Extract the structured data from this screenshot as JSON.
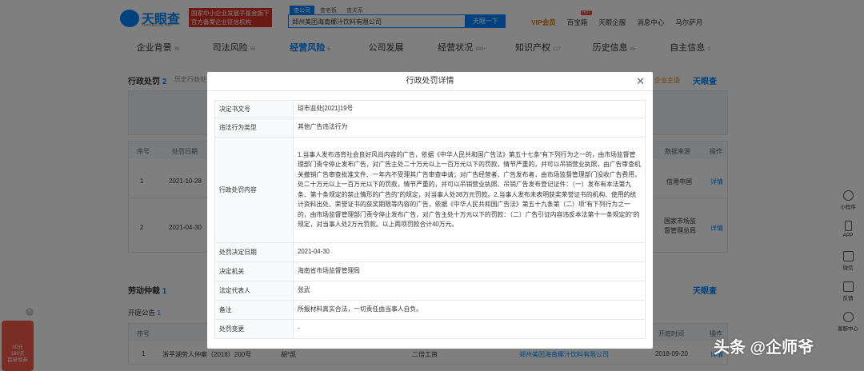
{
  "header": {
    "logo_text": "天眼查",
    "logo_sub": "TianYanCha.com",
    "promo_line1": "国家中小企业发展子基金旗下",
    "promo_line2": "官方备案企业征信机构",
    "search_tabs": [
      "查公司",
      "查老板",
      "查关系"
    ],
    "search_value": "郑州美团海南椰汁饮料有限公司",
    "search_button": "天眼一下",
    "links": {
      "vip": "VIP会员",
      "baibao": "百宝箱",
      "hot": "HOT",
      "enterprise": "天眼企服",
      "messages": "消息中心",
      "user": "马尔萨月"
    }
  },
  "nav": [
    {
      "label": "企业背景",
      "count": "38"
    },
    {
      "label": "司法风险",
      "count": "59"
    },
    {
      "label": "经营风险",
      "count": "5"
    },
    {
      "label": "公司发展",
      "count": ""
    },
    {
      "label": "经营状况",
      "count": "999+"
    },
    {
      "label": "知识产权",
      "count": "127"
    },
    {
      "label": "历史信息",
      "count": "65"
    },
    {
      "label": "自主信息",
      "count": "1"
    }
  ],
  "penalty_section": {
    "title": "行政处罚",
    "count": "2",
    "tab2": "历史行政处",
    "right_text": "企业主语",
    "logo": "天眼查",
    "headers": [
      "序号",
      "处罚日期",
      "数据来源",
      "操作"
    ],
    "rows": [
      {
        "no": "1",
        "date": "2021-10-28",
        "source": "信用中国",
        "action": "详情"
      },
      {
        "no": "2",
        "date": "2021-04-30",
        "source": "国家市场监督管理总局",
        "action": "详情"
      }
    ]
  },
  "labor_section": {
    "title": "劳动仲裁",
    "count": "1",
    "logo": "天眼查",
    "sub_title": "开庭公告",
    "sub_count": "1",
    "headers": [
      "序号",
      "开庭时间",
      "操作"
    ],
    "row": {
      "no": "1",
      "case": "浙平湖劳人仲案（2018）200号",
      "person": "胡*凯",
      "company": "郑州美团海南椰汁饮料有限公司",
      "time": "2018-09-20",
      "action": "详情"
    },
    "unlabeled": "二倍工资"
  },
  "modal": {
    "title": "行政处罚详情",
    "rows": [
      {
        "key": "决定书文号",
        "value": "琼市监处[2021]19号"
      },
      {
        "key": "违法行为类型",
        "value": "其他广告违法行为"
      },
      {
        "key": "行政处罚内容",
        "value": "1.当事人发布违背社会良好风尚内容的广告，依据《中华人民共和国广告法》第五十七条“有下列行为之一的，由市场监督管理部门责令停止发布广告，对广告主处二十万元以上一百万元以下的罚款，情节严重的，并可以吊销营业执照，由广告审查机关撤销广告审查批准文件、一年内不受理其广告审查申请；对广告经营者、广告发布者，由市场监督管理部门没收广告费用，处二十万元以上一百万元以下的罚款，情节严重的，并可以吊销营业执照、吊销广告发布登记证件：（一）发布有本法第九条、第十条规定的禁止情形的广告的”的规定，对当事人处38万元罚款。2.当事人发布未表明获奖荣誉证书的机构、使用的统计资料出处、荣誉证书的获奖期限等内容的广告，依据《中华人民共和国广告法》第五十九条第（二）项“有下列行为之一的，由市场监督管理部门责令停止发布广告，对广告主处十万元以下的罚款：（二）广告引证内容违反本法第十一条规定的”的规定，对当事人处2万元罚款。以上两项罚款合计40万元。"
      },
      {
        "key": "处罚决定日期",
        "value": "2021-04-30"
      },
      {
        "key": "决定机关",
        "value": "海南省市场监督管理局"
      },
      {
        "key": "法定代表人",
        "value": "张武"
      },
      {
        "key": "备注",
        "value": "所报材料真实合法，一切责任由当事人自负。"
      },
      {
        "key": "处罚变更",
        "value": "-"
      }
    ]
  },
  "right_sidebar": [
    "小程序",
    "APP",
    "微信",
    "反馈",
    "客服中心"
  ],
  "gift": {
    "line1": "30元",
    "line2": "180天",
    "line3": "首单领券"
  },
  "watermark": "头条 @企师爷",
  "colors": {
    "accent": "#0084ff",
    "promo_red": "#d93027",
    "vip_orange": "#d97a00"
  }
}
